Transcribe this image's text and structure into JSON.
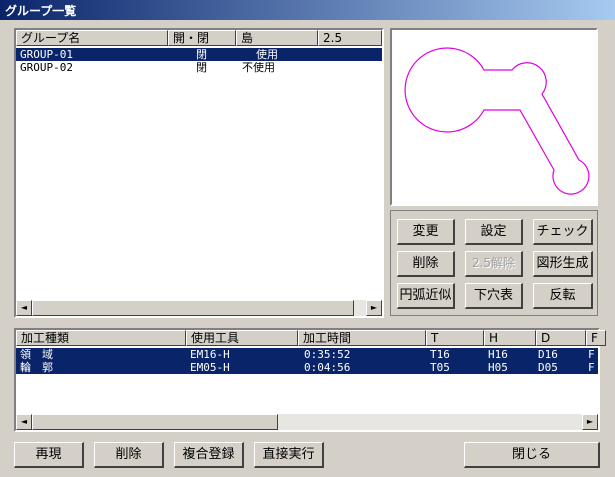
{
  "window": {
    "title": "グループ一覧"
  },
  "group_list": {
    "columns": [
      "グループ名",
      "開・閉",
      "島",
      "2.5"
    ],
    "rows": [
      {
        "name": "GROUP-01",
        "open_close": "閉",
        "island": "使用",
        "v25": "",
        "selected": true
      },
      {
        "name": "GROUP-02",
        "open_close": "閉",
        "island": "不使用",
        "v25": "",
        "selected": false
      }
    ]
  },
  "preview": {
    "shape_color": "#e000e0"
  },
  "buttons": {
    "change": "変更",
    "settings": "設定",
    "check": "チェック",
    "delete": "削除",
    "release_25": "2.5解除",
    "generate": "図形生成",
    "arc_approx": "円弧近似",
    "pilot_table": "下穴表",
    "reverse": "反転"
  },
  "process_list": {
    "columns": [
      "加工種類",
      "使用工具",
      "加工時間",
      "T",
      "H",
      "D",
      "F"
    ],
    "rows": [
      {
        "type": "領　域",
        "tool": "EM16-H",
        "time": "0:35:52",
        "t": "T16",
        "h": "H16",
        "d": "D16",
        "f": "F",
        "selected": true
      },
      {
        "type": "輪　郭",
        "tool": "EM05-H",
        "time": "0:04:56",
        "t": "T05",
        "h": "H05",
        "d": "D05",
        "f": "F",
        "selected": true
      }
    ]
  },
  "bottom_buttons": {
    "replay": "再現",
    "delete": "削除",
    "compound_register": "複合登録",
    "direct_exec": "直接実行",
    "close": "閉じる"
  },
  "scroll": {
    "left_arrow": "◄",
    "right_arrow": "►"
  }
}
